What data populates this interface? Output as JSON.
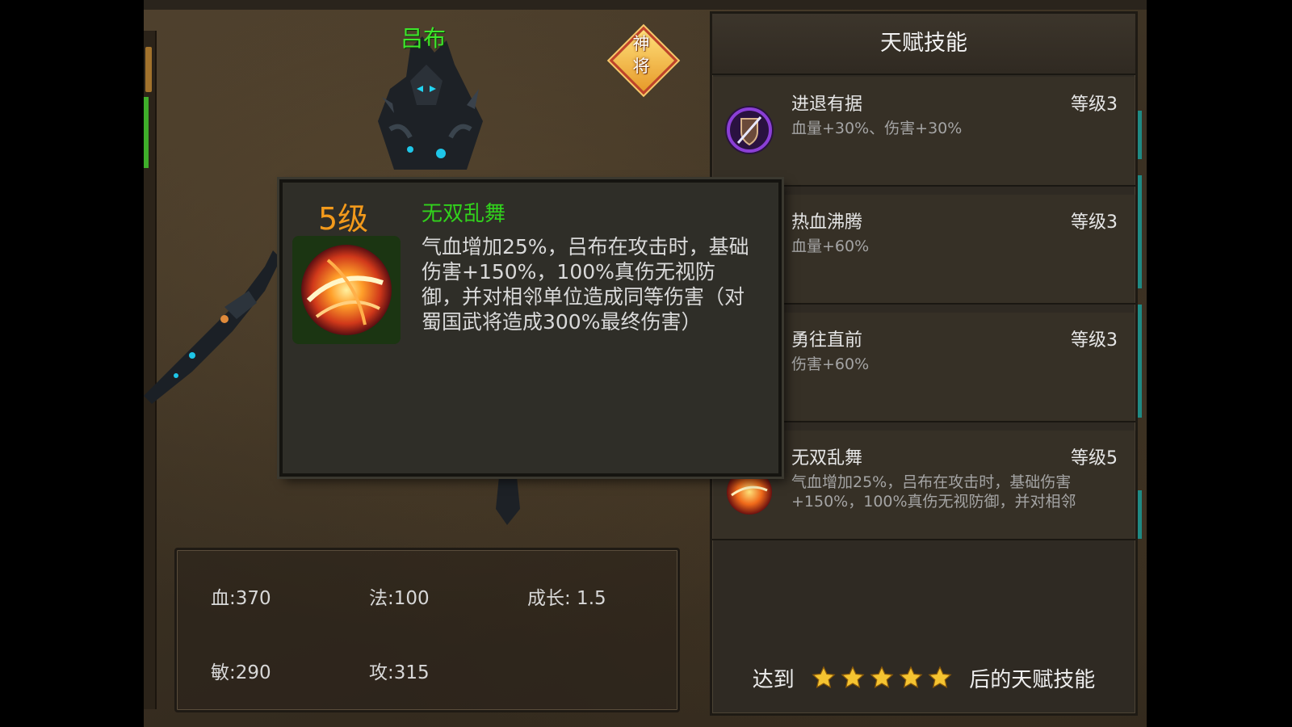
{
  "hero": {
    "name": "吕布",
    "badge": "神将",
    "name_color": "#3ee62b"
  },
  "stats": {
    "blood": "血:370",
    "magic": "法:100",
    "growth": "成长: 1.5",
    "agility": "敏:290",
    "attack": "攻:315"
  },
  "panel": {
    "title": "天赋技能",
    "skills": [
      {
        "name": "进退有据",
        "level": "等级3",
        "desc": "血量+30%、伤害+30%",
        "icon": "shield-sword-icon"
      },
      {
        "name": "热血沸腾",
        "level": "等级3",
        "desc": "血量+60%",
        "icon": "skill-icon"
      },
      {
        "name": "勇往直前",
        "level": "等级3",
        "desc": "伤害+60%",
        "icon": "skill-icon"
      },
      {
        "name": "无双乱舞",
        "level": "等级5",
        "desc": "气血增加25%，吕布在攻击时，基础伤害+150%，100%真伤无视防御，并对相邻",
        "icon": "fire-orb-icon"
      }
    ],
    "requirement_prefix": "达到",
    "requirement_suffix": "后的天赋技能",
    "requirement_stars": 5
  },
  "tooltip": {
    "level": "5级",
    "name": "无双乱舞",
    "description": "气血增加25%，吕布在攻击时，基础伤害+150%，100%真伤无视防御，并对相邻单位造成同等伤害（对蜀国武将造成300%最终伤害）",
    "icon": "fire-orb-icon",
    "level_color": "#f39a1b",
    "name_color": "#31d21c"
  }
}
